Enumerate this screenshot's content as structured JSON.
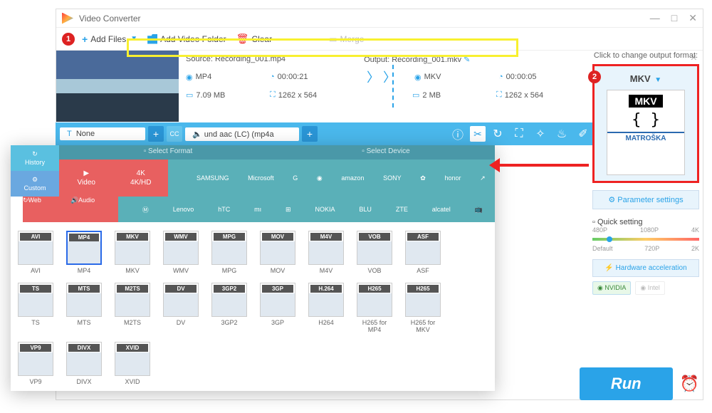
{
  "window": {
    "title": "Video Converter"
  },
  "toolbar": {
    "add_files": "Add Files",
    "add_folder": "Add Video Folder",
    "clear": "Clear",
    "merge": "Merge"
  },
  "file": {
    "source_label": "Source:",
    "source_name": "Recording_001.mp4",
    "output_label": "Output:",
    "output_name": "Recording_001.mkv",
    "src_fmt": "MP4",
    "src_dur": "00:00:21",
    "out_fmt": "MKV",
    "out_dur": "00:00:05",
    "src_size": "7.09 MB",
    "src_dim": "1262 x 564",
    "out_size": "2 MB",
    "out_dim": "1262 x 564"
  },
  "editbar": {
    "subtitle": "None",
    "audio": "und aac (LC) (mp4a"
  },
  "right": {
    "label": "Click to change output format:",
    "format": "MKV",
    "matroska": "MATROŠKA",
    "param": "Parameter settings",
    "quick": "Quick setting",
    "res": [
      "480P",
      "1080P",
      "4K",
      "Default",
      "720P",
      "2K"
    ],
    "hw": "Hardware acceleration",
    "nvidia": "NVIDIA",
    "intel": "Intel",
    "run": "Run"
  },
  "fmtpanel": {
    "side": [
      "History",
      "Custom"
    ],
    "tabs": [
      "Select Format",
      "Select Device"
    ],
    "cats": [
      "Video",
      "4K/HD",
      "Web",
      "Audio"
    ],
    "devices1": [
      "",
      "SAMSUNG",
      "Microsoft",
      "G",
      "",
      "amazon",
      "SONY",
      "",
      "honor",
      ""
    ],
    "devices2": [
      "",
      "Lenovo",
      "hTC",
      "",
      "",
      "NOKIA",
      "BLU",
      "ZTE",
      "alcatel",
      ""
    ],
    "formats": [
      {
        "tag": "AVI",
        "label": "AVI"
      },
      {
        "tag": "MP4",
        "label": "MP4",
        "selected": true
      },
      {
        "tag": "MKV",
        "label": "MKV"
      },
      {
        "tag": "WMV",
        "label": "WMV"
      },
      {
        "tag": "MPG",
        "label": "MPG"
      },
      {
        "tag": "MOV",
        "label": "MOV"
      },
      {
        "tag": "M4V",
        "label": "M4V"
      },
      {
        "tag": "VOB",
        "label": "VOB"
      },
      {
        "tag": "ASF",
        "label": "ASF"
      },
      {
        "tag": "TS",
        "label": "TS"
      },
      {
        "tag": "MTS",
        "label": "MTS"
      },
      {
        "tag": "M2TS",
        "label": "M2TS"
      },
      {
        "tag": "DV",
        "label": "DV"
      },
      {
        "tag": "3GP2",
        "label": "3GP2"
      },
      {
        "tag": "3GP",
        "label": "3GP"
      },
      {
        "tag": "H.264",
        "label": "H264"
      },
      {
        "tag": "H265",
        "label": "H265 for MP4"
      },
      {
        "tag": "H265",
        "label": "H265 for MKV"
      },
      {
        "tag": "VP9",
        "label": "VP9"
      },
      {
        "tag": "DIVX",
        "label": "DIVX"
      },
      {
        "tag": "XVID",
        "label": "XVID"
      }
    ]
  },
  "badges": {
    "one": "1",
    "two": "2"
  }
}
